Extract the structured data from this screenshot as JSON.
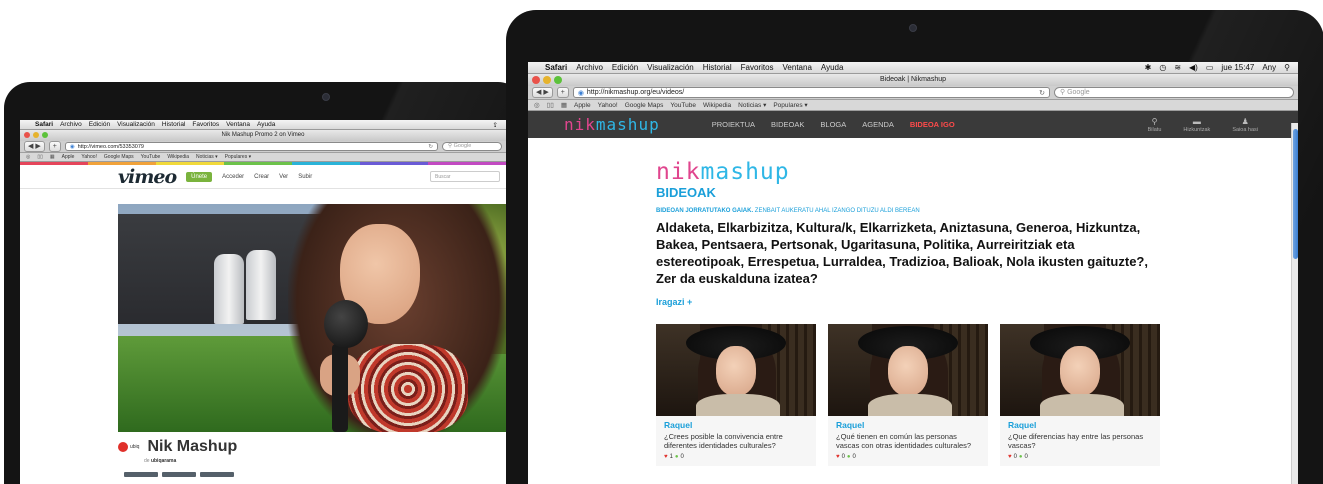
{
  "mac_menu": {
    "app": "Safari",
    "items": [
      "Archivo",
      "Edición",
      "Visualización",
      "Historial",
      "Favoritos",
      "Ventana",
      "Ayuda"
    ]
  },
  "left": {
    "window_title": "Nik Mashup Promo 2 on Vimeo",
    "url": "http://vimeo.com/53353079",
    "search_placeholder": "Google",
    "bookmarks": [
      "Apple",
      "Yahoo!",
      "Google Maps",
      "YouTube",
      "Wikipedia",
      "Noticias ▾",
      "Populares ▾"
    ],
    "vimeo": {
      "logo": "vimeo",
      "join_button": "Únete",
      "nav": [
        "Acceder",
        "Crear",
        "Ver",
        "Subir"
      ],
      "search_placeholder": "Buscar",
      "video_title": "Nik Mashup",
      "channel_logo_text": "ubiq",
      "byline_prefix": "de",
      "byline_user": "ubiqarama"
    }
  },
  "right": {
    "window_title": "Bideoak | Nikmashup",
    "url": "http://nikmashup.org/eu/videos/",
    "search_placeholder": "Google",
    "menubar_time": "jue 15:47",
    "menubar_user": "Any",
    "bookmarks": [
      "Apple",
      "Yahoo!",
      "Google Maps",
      "YouTube",
      "Wikipedia",
      "Noticias ▾",
      "Populares ▾"
    ],
    "site": {
      "logo_pink": "nik",
      "logo_blue": "mashup",
      "nav": [
        "PROIEKTUA",
        "BIDEOAK",
        "BLOGA",
        "AGENDA"
      ],
      "nav_highlight": "BIDEOA IGO",
      "icons": [
        {
          "label": "Bilatu",
          "icon": "search-icon"
        },
        {
          "label": "Hizkuntzak",
          "icon": "chat-icon"
        },
        {
          "label": "Saioa hasi",
          "icon": "user-icon"
        }
      ],
      "section_title": "BIDEOAK",
      "topics_label_bold": "BIDEOAN JORRATUTAKO GAIAK.",
      "topics_label_rest": "ZENBAIT AUKERATU AHAL IZANGO DITUZU ALDI BEREAN",
      "topics": "Aldaketa, Elkarbizitza, Kultura/k, Elkarrizketa, Aniztasuna, Generoa, Hizkuntza, Bakea, Pentsaera, Pertsonak, Ugaritasuna, Politika, Aurreiritziak eta estereotipoak, Errespetua, Lurraldea, Tradizioa, Balioak, Nola ikusten gaituzte?, Zer da euskalduna izatea?",
      "filter": "Iragazi +",
      "cards": [
        {
          "name": "Raquel",
          "question": "¿Crees posible la convivencia entre diferentes identidades culturales?",
          "likes": "1",
          "comments": "0"
        },
        {
          "name": "Raquel",
          "question": "¿Qué tienen en común las personas vascas con otras identidades culturales?",
          "likes": "0",
          "comments": "0"
        },
        {
          "name": "Raquel",
          "question": "¿Que diferencias hay entre las personas vascas?",
          "likes": "0",
          "comments": "0"
        }
      ]
    }
  }
}
